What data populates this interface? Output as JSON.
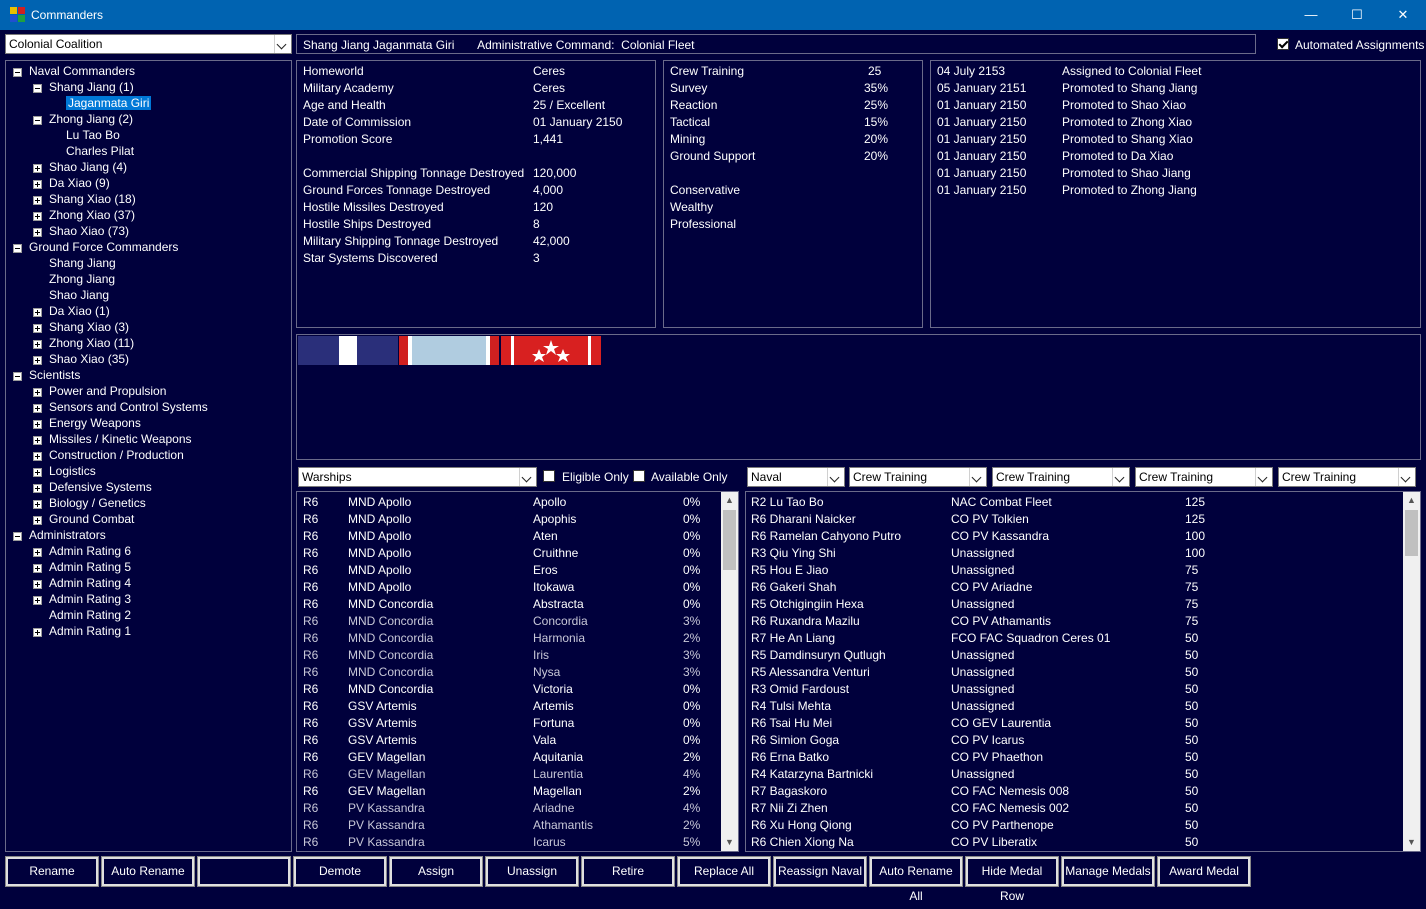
{
  "window": {
    "title": "Commanders",
    "minimize": "—",
    "maximize": "☐",
    "close": "✕"
  },
  "race_select": "Colonial Coalition",
  "header_info": "Shang Jiang Jaganmata Giri       Administrative Command:  Colonial Fleet",
  "automated_assignments": {
    "label": "Automated Assignments",
    "checked": true
  },
  "tree": [
    {
      "label": "Naval Commanders",
      "level": 0,
      "exp": "minus"
    },
    {
      "label": "Shang Jiang (1)",
      "level": 1,
      "exp": "minus"
    },
    {
      "label": "Jaganmata Giri",
      "level": 2,
      "exp": "",
      "selected": true
    },
    {
      "label": "Zhong Jiang (2)",
      "level": 1,
      "exp": "minus"
    },
    {
      "label": "Lu Tao Bo",
      "level": 2,
      "exp": ""
    },
    {
      "label": "Charles Pilat",
      "level": 2,
      "exp": ""
    },
    {
      "label": "Shao Jiang (4)",
      "level": 1,
      "exp": "plus"
    },
    {
      "label": "Da Xiao (9)",
      "level": 1,
      "exp": "plus"
    },
    {
      "label": "Shang Xiao (18)",
      "level": 1,
      "exp": "plus"
    },
    {
      "label": "Zhong Xiao (37)",
      "level": 1,
      "exp": "plus"
    },
    {
      "label": "Shao Xiao (73)",
      "level": 1,
      "exp": "plus"
    },
    {
      "label": "Ground Force Commanders",
      "level": 0,
      "exp": "minus"
    },
    {
      "label": "Shang Jiang",
      "level": 1,
      "exp": ""
    },
    {
      "label": "Zhong Jiang",
      "level": 1,
      "exp": ""
    },
    {
      "label": "Shao Jiang",
      "level": 1,
      "exp": ""
    },
    {
      "label": "Da Xiao (1)",
      "level": 1,
      "exp": "plus"
    },
    {
      "label": "Shang Xiao (3)",
      "level": 1,
      "exp": "plus"
    },
    {
      "label": "Zhong Xiao (11)",
      "level": 1,
      "exp": "plus"
    },
    {
      "label": "Shao Xiao (35)",
      "level": 1,
      "exp": "plus"
    },
    {
      "label": "Scientists",
      "level": 0,
      "exp": "minus"
    },
    {
      "label": "Power and Propulsion",
      "level": 1,
      "exp": "plus"
    },
    {
      "label": "Sensors and Control Systems",
      "level": 1,
      "exp": "plus"
    },
    {
      "label": "Energy Weapons",
      "level": 1,
      "exp": "plus"
    },
    {
      "label": "Missiles / Kinetic Weapons",
      "level": 1,
      "exp": "plus"
    },
    {
      "label": "Construction / Production",
      "level": 1,
      "exp": "plus"
    },
    {
      "label": "Logistics",
      "level": 1,
      "exp": "plus"
    },
    {
      "label": "Defensive Systems",
      "level": 1,
      "exp": "plus"
    },
    {
      "label": "Biology / Genetics",
      "level": 1,
      "exp": "plus"
    },
    {
      "label": "Ground Combat",
      "level": 1,
      "exp": "plus"
    },
    {
      "label": "Administrators",
      "level": 0,
      "exp": "minus"
    },
    {
      "label": "Admin Rating 6",
      "level": 1,
      "exp": "plus"
    },
    {
      "label": "Admin Rating 5",
      "level": 1,
      "exp": "plus"
    },
    {
      "label": "Admin Rating 4",
      "level": 1,
      "exp": "plus"
    },
    {
      "label": "Admin Rating 3",
      "level": 1,
      "exp": "plus"
    },
    {
      "label": "Admin Rating 2",
      "level": 1,
      "exp": ""
    },
    {
      "label": "Admin Rating 1",
      "level": 1,
      "exp": "plus"
    }
  ],
  "stats": [
    [
      "Homeworld",
      "Ceres"
    ],
    [
      "Military Academy",
      "Ceres"
    ],
    [
      "Age and Health",
      "25 / Excellent"
    ],
    [
      "Date of Commission",
      "01 January 2150"
    ],
    [
      "Promotion Score",
      "1,441"
    ],
    [
      "",
      ""
    ],
    [
      "Commercial Shipping Tonnage Destroyed",
      "120,000"
    ],
    [
      "Ground Forces Tonnage Destroyed",
      "4,000"
    ],
    [
      "Hostile Missiles Destroyed",
      "120"
    ],
    [
      "Hostile Ships Destroyed",
      "8"
    ],
    [
      "Military Shipping Tonnage Destroyed",
      "42,000"
    ],
    [
      "Star Systems Discovered",
      "3"
    ]
  ],
  "bonuses": [
    [
      "Crew Training",
      "25"
    ],
    [
      "Survey",
      "35%"
    ],
    [
      "Reaction",
      "25%"
    ],
    [
      "Tactical",
      "15%"
    ],
    [
      "Mining",
      "20%"
    ],
    [
      "Ground Support",
      "20%"
    ],
    [
      "",
      ""
    ],
    [
      "Conservative",
      ""
    ],
    [
      "Wealthy",
      ""
    ],
    [
      "Professional",
      ""
    ]
  ],
  "history": [
    [
      "04 July 2153",
      "Assigned to Colonial Fleet"
    ],
    [
      "05 January 2151",
      "Promoted to Shang Jiang"
    ],
    [
      "01 January 2150",
      "Promoted to Shao Xiao"
    ],
    [
      "01 January 2150",
      "Promoted to Zhong Xiao"
    ],
    [
      "01 January 2150",
      "Promoted to Shang Xiao"
    ],
    [
      "01 January 2150",
      "Promoted to Da Xiao"
    ],
    [
      "01 January 2150",
      "Promoted to Shao Jiang"
    ],
    [
      "01 January 2150",
      "Promoted to Zhong Jiang"
    ]
  ],
  "ships_filter": {
    "type": "Warships",
    "eligible_only": "Eligible Only",
    "available_only": "Available Only"
  },
  "ships": [
    [
      "R6",
      "MND Apollo",
      "Apollo",
      "0%",
      false
    ],
    [
      "R6",
      "MND Apollo",
      "Apophis",
      "0%",
      false
    ],
    [
      "R6",
      "MND Apollo",
      "Aten",
      "0%",
      false
    ],
    [
      "R6",
      "MND Apollo",
      "Cruithne",
      "0%",
      false
    ],
    [
      "R6",
      "MND Apollo",
      "Eros",
      "0%",
      false
    ],
    [
      "R6",
      "MND Apollo",
      "Itokawa",
      "0%",
      false
    ],
    [
      "R6",
      "MND Concordia",
      "Abstracta",
      "0%",
      false
    ],
    [
      "R6",
      "MND Concordia",
      "Concordia",
      "3%",
      true
    ],
    [
      "R6",
      "MND Concordia",
      "Harmonia",
      "2%",
      true
    ],
    [
      "R6",
      "MND Concordia",
      "Iris",
      "3%",
      true
    ],
    [
      "R6",
      "MND Concordia",
      "Nysa",
      "3%",
      true
    ],
    [
      "R6",
      "MND Concordia",
      "Victoria",
      "0%",
      false
    ],
    [
      "R6",
      "GSV Artemis",
      "Artemis",
      "0%",
      false
    ],
    [
      "R6",
      "GSV Artemis",
      "Fortuna",
      "0%",
      false
    ],
    [
      "R6",
      "GSV Artemis",
      "Vala",
      "0%",
      false
    ],
    [
      "R6",
      "GEV Magellan",
      "Aquitania",
      "2%",
      false
    ],
    [
      "R6",
      "GEV Magellan",
      "Laurentia",
      "4%",
      true
    ],
    [
      "R6",
      "GEV Magellan",
      "Magellan",
      "2%",
      false
    ],
    [
      "R6",
      "PV Kassandra",
      "Ariadne",
      "4%",
      true
    ],
    [
      "R6",
      "PV Kassandra",
      "Athamantis",
      "2%",
      true
    ],
    [
      "R6",
      "PV Kassandra",
      "Icarus",
      "5%",
      true
    ]
  ],
  "officer_filters": [
    "Naval",
    "Crew Training",
    "Crew Training",
    "Crew Training",
    "Crew Training"
  ],
  "officers": [
    [
      "R2 Lu Tao Bo",
      "NAC Combat Fleet",
      "125"
    ],
    [
      "R6 Dharani Naicker",
      "CO PV Tolkien",
      "125"
    ],
    [
      "R6 Ramelan Cahyono Putro",
      "CO PV Kassandra",
      "100"
    ],
    [
      "R3 Qiu Ying Shi",
      "Unassigned",
      "100"
    ],
    [
      "R5 Hou E Jiao",
      "Unassigned",
      "75"
    ],
    [
      "R6 Gakeri Shah",
      "CO PV Ariadne",
      "75"
    ],
    [
      "R5 Otchigingiin Hexa",
      "Unassigned",
      "75"
    ],
    [
      "R6 Ruxandra Mazilu",
      "CO PV Athamantis",
      "75"
    ],
    [
      "R7 He An Liang",
      "FCO FAC Squadron Ceres 01",
      "50"
    ],
    [
      "R5 Damdinsuryn Qutlugh",
      "Unassigned",
      "50"
    ],
    [
      "R5 Alessandra Venturi",
      "Unassigned",
      "50"
    ],
    [
      "R3 Omid Fardoust",
      "Unassigned",
      "50"
    ],
    [
      "R4 Tulsi Mehta",
      "Unassigned",
      "50"
    ],
    [
      "R6 Tsai Hu Mei",
      "CO GEV Laurentia",
      "50"
    ],
    [
      "R6 Simion Goga",
      "CO PV Icarus",
      "50"
    ],
    [
      "R6 Erna Batko",
      "CO PV Phaethon",
      "50"
    ],
    [
      "R4 Katarzyna Bartnicki",
      "Unassigned",
      "50"
    ],
    [
      "R7 Bagaskoro",
      "CO FAC Nemesis 008",
      "50"
    ],
    [
      "R7 Nii Zi Zhen",
      "CO FAC Nemesis 002",
      "50"
    ],
    [
      "R6 Xu Hong Qiong",
      "CO PV Parthenope",
      "50"
    ],
    [
      "R6 Chien Xiong Na",
      "CO PV Liberatix",
      "50"
    ]
  ],
  "buttons": [
    "Rename",
    "Auto Rename",
    "",
    "Demote",
    "Assign",
    "Unassign",
    "Retire",
    "Replace All",
    "Reassign Naval",
    "Auto Rename All",
    "Hide Medal Row",
    "Manage Medals",
    "Award Medal"
  ],
  "colors": {
    "background": "#00003c",
    "titlebar": "#0063b1",
    "selection": "#0078d7"
  }
}
